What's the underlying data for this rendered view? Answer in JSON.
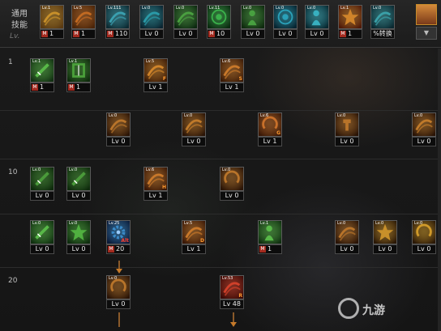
{
  "header": {
    "title_line1": "通用",
    "title_line2": "技能",
    "lv_tag": "Lv."
  },
  "top_skills": [
    {
      "icon": "fist-icon",
      "lv": "Lv.1",
      "value": "1",
      "m": true,
      "c1": "#c8902a",
      "c2": "#5a3a12"
    },
    {
      "icon": "kick-icon",
      "lv": "Lv.5",
      "value": "1",
      "m": true,
      "c1": "#c26a22",
      "c2": "#4a2408"
    },
    {
      "icon": "claw-icon",
      "lv": "Lv.111",
      "value": "110",
      "m": true,
      "c1": "#3aa0b0",
      "c2": "#0c2a32"
    },
    {
      "icon": "wings-icon",
      "lv": "Lv.0",
      "value": "Lv 0",
      "m": false,
      "c1": "#2a9aa8",
      "c2": "#0a2430"
    },
    {
      "icon": "dash-icon",
      "lv": "Lv.0",
      "value": "Lv 0",
      "m": false,
      "c1": "#4aa040",
      "c2": "#0c2810"
    },
    {
      "icon": "target-icon",
      "lv": "Lv.11",
      "value": "10",
      "m": true,
      "c1": "#3ab04a",
      "c2": "#0a2a10"
    },
    {
      "icon": "runner-icon",
      "lv": "Lv.0",
      "value": "Lv 0",
      "m": false,
      "c1": "#48a040",
      "c2": "#0e2a0e"
    },
    {
      "icon": "eye-icon",
      "lv": "Lv.0",
      "value": "Lv 0",
      "m": false,
      "c1": "#2aa0b8",
      "c2": "#062430"
    },
    {
      "icon": "body-icon",
      "lv": "Lv.0",
      "value": "Lv 0",
      "m": false,
      "c1": "#38b0c0",
      "c2": "#082830"
    },
    {
      "icon": "burst-icon",
      "lv": "Lv.1",
      "value": "1",
      "m": true,
      "c1": "#d0842a",
      "c2": "#501a08"
    },
    {
      "icon": "magic-book-icon",
      "lv": "Lv.0",
      "value": "%转换",
      "m": false,
      "c1": "#3aa0a8",
      "c2": "#0a2830"
    }
  ],
  "rows": [
    {
      "label": "1"
    },
    {
      "label": ""
    },
    {
      "label": "10"
    },
    {
      "label": ""
    },
    {
      "label": "20"
    }
  ],
  "grid_skills": [
    {
      "name": "skill-green-sword",
      "icon": "sword-icon",
      "lv": "Lv.1",
      "value": "1",
      "m": true,
      "c1": "#58b848",
      "c2": "#123012",
      "corner": ""
    },
    {
      "name": "skill-green-shield",
      "icon": "shield-icon",
      "lv": "Lv.1",
      "value": "1",
      "m": true,
      "c1": "#4aa03a",
      "c2": "#0e2a0c",
      "corner": ""
    },
    {
      "name": "skill-orange-slash-f",
      "icon": "slash-icon",
      "lv": "Lv.5",
      "value": "Lv 1",
      "m": false,
      "c1": "#d0842a",
      "c2": "#3a1a06",
      "corner": "F"
    },
    {
      "name": "skill-orange-wave-s",
      "icon": "wave-icon",
      "lv": "Lv.6",
      "value": "Lv 1",
      "m": false,
      "c1": "#c8782a",
      "c2": "#3a1a06",
      "corner": "S"
    },
    {
      "name": "skill-orange-claws",
      "icon": "claws-icon",
      "lv": "Lv.0",
      "value": "Lv 0",
      "m": false,
      "c1": "#b8742a",
      "c2": "#2a1406",
      "corner": ""
    },
    {
      "name": "skill-orange-spear",
      "icon": "spear-icon",
      "lv": "Lv.0",
      "value": "Lv 0",
      "m": false,
      "c1": "#c07a2a",
      "c2": "#2a1406",
      "corner": ""
    },
    {
      "name": "skill-orange-spin-g",
      "icon": "spin-icon",
      "lv": "Lv.6",
      "value": "Lv 1",
      "m": false,
      "c1": "#c8702a",
      "c2": "#3a1806",
      "corner": "G"
    },
    {
      "name": "skill-orange-cross",
      "icon": "cross-icon",
      "lv": "Lv.0",
      "value": "Lv 0",
      "m": false,
      "c1": "#b8742a",
      "c2": "#2a1406",
      "corner": ""
    },
    {
      "name": "skill-orange-fang",
      "icon": "fang-icon",
      "lv": "Lv.0",
      "value": "Lv 0",
      "m": false,
      "c1": "#c07a2a",
      "c2": "#2a1406",
      "corner": ""
    },
    {
      "name": "skill-green-blade",
      "icon": "blade-icon",
      "lv": "Lv.0",
      "value": "Lv 0",
      "m": false,
      "c1": "#4a9a3a",
      "c2": "#0e2a0c",
      "corner": ""
    },
    {
      "name": "skill-green-dagger",
      "icon": "dagger-icon",
      "lv": "Lv.0",
      "value": "Lv 0",
      "m": false,
      "c1": "#4a9a3a",
      "c2": "#0e2a0c",
      "corner": ""
    },
    {
      "name": "skill-orange-rush-h",
      "icon": "rush-icon",
      "lv": "Lv.6",
      "value": "Lv 1",
      "m": false,
      "c1": "#c8782a",
      "c2": "#3a1806",
      "corner": "H"
    },
    {
      "name": "skill-orange-swirl",
      "icon": "swirl-icon",
      "lv": "Lv.0",
      "value": "Lv 0",
      "m": false,
      "c1": "#b8742a",
      "c2": "#2a1406",
      "corner": ""
    },
    {
      "name": "skill-green-strike",
      "icon": "strike-icon",
      "lv": "Lv.0",
      "value": "Lv 0",
      "m": false,
      "c1": "#58b848",
      "c2": "#103010",
      "corner": ""
    },
    {
      "name": "skill-green-explode",
      "icon": "explode-icon",
      "lv": "Lv.0",
      "value": "Lv 0",
      "m": false,
      "c1": "#50b040",
      "c2": "#0e2c0e",
      "corner": ""
    },
    {
      "name": "skill-blue-alt",
      "icon": "gear-icon",
      "lv": "Lv.25",
      "value": "20",
      "m": true,
      "c1": "#3a8ac8",
      "c2": "#0a1a38",
      "corner": "Alt"
    },
    {
      "name": "skill-orange-crash-d",
      "icon": "crash-icon",
      "lv": "Lv.5",
      "value": "Lv 1",
      "m": false,
      "c1": "#c8782a",
      "c2": "#3a1806",
      "corner": "D"
    },
    {
      "name": "skill-green-buff",
      "icon": "buff-icon",
      "lv": "Lv.1",
      "value": "1",
      "m": true,
      "c1": "#58b848",
      "c2": "#103010",
      "corner": ""
    },
    {
      "name": "skill-orange-arc",
      "icon": "arc-icon",
      "lv": "Lv.0",
      "value": "Lv 0",
      "m": false,
      "c1": "#b8742a",
      "c2": "#2a1406",
      "corner": ""
    },
    {
      "name": "skill-orange-spark",
      "icon": "spark-icon",
      "lv": "Lv.0",
      "value": "Lv 0",
      "m": false,
      "c1": "#c8902a",
      "c2": "#2a1806",
      "corner": ""
    },
    {
      "name": "skill-orange-moon",
      "icon": "moon-icon",
      "lv": "Lv.0",
      "value": "Lv 0",
      "m": false,
      "c1": "#d09a2a",
      "c2": "#2a1806",
      "corner": ""
    },
    {
      "name": "skill-orange-ring",
      "icon": "ring-icon",
      "lv": "Lv.0",
      "value": "Lv 0",
      "m": false,
      "c1": "#b8742a",
      "c2": "#2a1406",
      "corner": ""
    },
    {
      "name": "skill-red-ultimate-r",
      "icon": "comet-icon",
      "lv": "Lv.53",
      "value": "Lv 48",
      "m": false,
      "c1": "#d0402a",
      "c2": "#3a0a06",
      "corner": "R"
    }
  ],
  "watermark": {
    "text": "九游"
  },
  "colors": {
    "orange": "#c67a2a",
    "panel": "#151515",
    "m_badge": "#a32a1f"
  }
}
